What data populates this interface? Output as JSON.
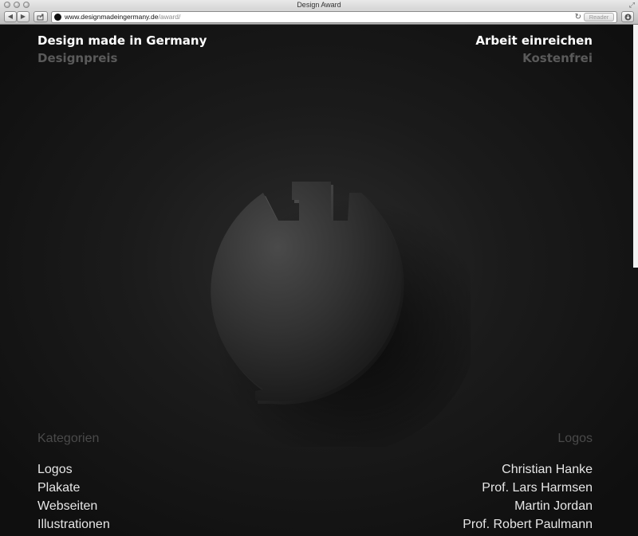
{
  "window": {
    "title": "Design Award"
  },
  "toolbar": {
    "back_icon": "back-arrow-icon",
    "forward_icon": "forward-arrow-icon",
    "share_icon": "share-icon",
    "reload_icon": "reload-icon",
    "downloads_icon": "downloads-icon",
    "fullscreen_icon": "fullscreen-icon",
    "url_host": "www.designmadeingermany.de",
    "url_path": "/award/",
    "reader_label": "Reader"
  },
  "header": {
    "site_title": "Design made in Germany",
    "site_subtitle": "Designpreis",
    "cta_title": "Arbeit einreichen",
    "cta_subtitle": "Kostenfrei"
  },
  "categories": {
    "heading": "Kategorien",
    "items": [
      "Logos",
      "Plakate",
      "Webseiten",
      "Illustrationen"
    ]
  },
  "jury": {
    "heading": "Logos",
    "members": [
      "Christian Hanke",
      "Prof. Lars Harmsen",
      "Martin Jordan",
      "Prof. Robert Paulmann"
    ]
  },
  "colors": {
    "background": "#1b1b1b",
    "text_primary": "#ffffff",
    "text_muted": "#5a5a5a",
    "emblem": "#3a3a3a"
  }
}
